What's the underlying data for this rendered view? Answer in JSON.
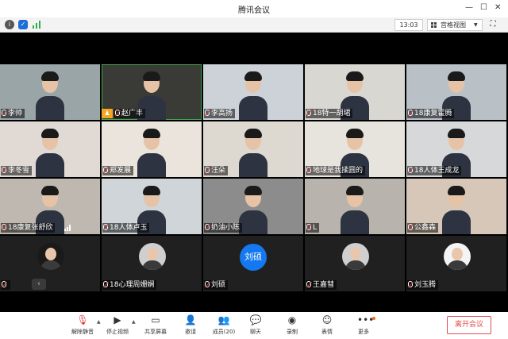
{
  "window": {
    "title": "腾讯会议"
  },
  "status": {
    "time": "13:03",
    "view_label": "宫格视图"
  },
  "tiles": [
    {
      "name": "李帅",
      "bg": "#9aa5a8"
    },
    {
      "name": "赵广丰",
      "bg": "#3a3a36"
    },
    {
      "name": "李高扬",
      "bg": "#cdd2d8"
    },
    {
      "name": "18特一胡珺",
      "bg": "#d9d7d2"
    },
    {
      "name": "18康复霍腾",
      "bg": "#b9c1c7"
    },
    {
      "name": "李冬雪",
      "bg": "#e1d9d3"
    },
    {
      "name": "郑发展",
      "bg": "#eae4dc"
    },
    {
      "name": "汪朵",
      "bg": "#ddd8d0"
    },
    {
      "name": "地球是我揉圆的",
      "bg": "#e7e3dd"
    },
    {
      "name": "18人体王成龙",
      "bg": "#d6d8da"
    },
    {
      "name": "18康复张舒欣",
      "bg": "#bfb8b0"
    },
    {
      "name": "18人体卢玉",
      "bg": "#cfd5d9"
    },
    {
      "name": "奶油小陈",
      "bg": "#8c8c8c"
    },
    {
      "name": "L",
      "bg": "#b8b4ad"
    },
    {
      "name": "公鑫森",
      "bg": "#d6c7b8"
    },
    {
      "name": "",
      "bg": ""
    },
    {
      "name": "18心理周姗娴",
      "bg": ""
    },
    {
      "name": "刘硕",
      "bg": "",
      "initial": "刘硕"
    },
    {
      "name": "王嘉彗",
      "bg": ""
    },
    {
      "name": "刘玉腾",
      "bg": ""
    }
  ],
  "toolbar": {
    "mute": "解除静音",
    "video": "停止视频",
    "share": "共享屏幕",
    "invite": "邀请",
    "members_label": "成员(20)",
    "chat": "聊天",
    "record": "录制",
    "emoji": "表情",
    "more": "更多",
    "leave": "离开会议"
  }
}
